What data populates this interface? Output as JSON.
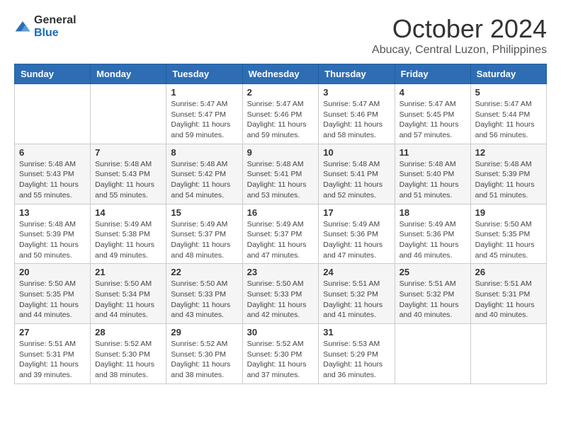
{
  "header": {
    "logo": {
      "text_general": "General",
      "text_blue": "Blue"
    },
    "month": "October 2024",
    "location": "Abucay, Central Luzon, Philippines"
  },
  "days_of_week": [
    "Sunday",
    "Monday",
    "Tuesday",
    "Wednesday",
    "Thursday",
    "Friday",
    "Saturday"
  ],
  "weeks": [
    [
      {
        "day": "",
        "sunrise": "",
        "sunset": "",
        "daylight": ""
      },
      {
        "day": "",
        "sunrise": "",
        "sunset": "",
        "daylight": ""
      },
      {
        "day": "1",
        "sunrise": "Sunrise: 5:47 AM",
        "sunset": "Sunset: 5:47 PM",
        "daylight": "Daylight: 11 hours and 59 minutes."
      },
      {
        "day": "2",
        "sunrise": "Sunrise: 5:47 AM",
        "sunset": "Sunset: 5:46 PM",
        "daylight": "Daylight: 11 hours and 59 minutes."
      },
      {
        "day": "3",
        "sunrise": "Sunrise: 5:47 AM",
        "sunset": "Sunset: 5:46 PM",
        "daylight": "Daylight: 11 hours and 58 minutes."
      },
      {
        "day": "4",
        "sunrise": "Sunrise: 5:47 AM",
        "sunset": "Sunset: 5:45 PM",
        "daylight": "Daylight: 11 hours and 57 minutes."
      },
      {
        "day": "5",
        "sunrise": "Sunrise: 5:47 AM",
        "sunset": "Sunset: 5:44 PM",
        "daylight": "Daylight: 11 hours and 56 minutes."
      }
    ],
    [
      {
        "day": "6",
        "sunrise": "Sunrise: 5:48 AM",
        "sunset": "Sunset: 5:43 PM",
        "daylight": "Daylight: 11 hours and 55 minutes."
      },
      {
        "day": "7",
        "sunrise": "Sunrise: 5:48 AM",
        "sunset": "Sunset: 5:43 PM",
        "daylight": "Daylight: 11 hours and 55 minutes."
      },
      {
        "day": "8",
        "sunrise": "Sunrise: 5:48 AM",
        "sunset": "Sunset: 5:42 PM",
        "daylight": "Daylight: 11 hours and 54 minutes."
      },
      {
        "day": "9",
        "sunrise": "Sunrise: 5:48 AM",
        "sunset": "Sunset: 5:41 PM",
        "daylight": "Daylight: 11 hours and 53 minutes."
      },
      {
        "day": "10",
        "sunrise": "Sunrise: 5:48 AM",
        "sunset": "Sunset: 5:41 PM",
        "daylight": "Daylight: 11 hours and 52 minutes."
      },
      {
        "day": "11",
        "sunrise": "Sunrise: 5:48 AM",
        "sunset": "Sunset: 5:40 PM",
        "daylight": "Daylight: 11 hours and 51 minutes."
      },
      {
        "day": "12",
        "sunrise": "Sunrise: 5:48 AM",
        "sunset": "Sunset: 5:39 PM",
        "daylight": "Daylight: 11 hours and 51 minutes."
      }
    ],
    [
      {
        "day": "13",
        "sunrise": "Sunrise: 5:48 AM",
        "sunset": "Sunset: 5:39 PM",
        "daylight": "Daylight: 11 hours and 50 minutes."
      },
      {
        "day": "14",
        "sunrise": "Sunrise: 5:49 AM",
        "sunset": "Sunset: 5:38 PM",
        "daylight": "Daylight: 11 hours and 49 minutes."
      },
      {
        "day": "15",
        "sunrise": "Sunrise: 5:49 AM",
        "sunset": "Sunset: 5:37 PM",
        "daylight": "Daylight: 11 hours and 48 minutes."
      },
      {
        "day": "16",
        "sunrise": "Sunrise: 5:49 AM",
        "sunset": "Sunset: 5:37 PM",
        "daylight": "Daylight: 11 hours and 47 minutes."
      },
      {
        "day": "17",
        "sunrise": "Sunrise: 5:49 AM",
        "sunset": "Sunset: 5:36 PM",
        "daylight": "Daylight: 11 hours and 47 minutes."
      },
      {
        "day": "18",
        "sunrise": "Sunrise: 5:49 AM",
        "sunset": "Sunset: 5:36 PM",
        "daylight": "Daylight: 11 hours and 46 minutes."
      },
      {
        "day": "19",
        "sunrise": "Sunrise: 5:50 AM",
        "sunset": "Sunset: 5:35 PM",
        "daylight": "Daylight: 11 hours and 45 minutes."
      }
    ],
    [
      {
        "day": "20",
        "sunrise": "Sunrise: 5:50 AM",
        "sunset": "Sunset: 5:35 PM",
        "daylight": "Daylight: 11 hours and 44 minutes."
      },
      {
        "day": "21",
        "sunrise": "Sunrise: 5:50 AM",
        "sunset": "Sunset: 5:34 PM",
        "daylight": "Daylight: 11 hours and 44 minutes."
      },
      {
        "day": "22",
        "sunrise": "Sunrise: 5:50 AM",
        "sunset": "Sunset: 5:33 PM",
        "daylight": "Daylight: 11 hours and 43 minutes."
      },
      {
        "day": "23",
        "sunrise": "Sunrise: 5:50 AM",
        "sunset": "Sunset: 5:33 PM",
        "daylight": "Daylight: 11 hours and 42 minutes."
      },
      {
        "day": "24",
        "sunrise": "Sunrise: 5:51 AM",
        "sunset": "Sunset: 5:32 PM",
        "daylight": "Daylight: 11 hours and 41 minutes."
      },
      {
        "day": "25",
        "sunrise": "Sunrise: 5:51 AM",
        "sunset": "Sunset: 5:32 PM",
        "daylight": "Daylight: 11 hours and 40 minutes."
      },
      {
        "day": "26",
        "sunrise": "Sunrise: 5:51 AM",
        "sunset": "Sunset: 5:31 PM",
        "daylight": "Daylight: 11 hours and 40 minutes."
      }
    ],
    [
      {
        "day": "27",
        "sunrise": "Sunrise: 5:51 AM",
        "sunset": "Sunset: 5:31 PM",
        "daylight": "Daylight: 11 hours and 39 minutes."
      },
      {
        "day": "28",
        "sunrise": "Sunrise: 5:52 AM",
        "sunset": "Sunset: 5:30 PM",
        "daylight": "Daylight: 11 hours and 38 minutes."
      },
      {
        "day": "29",
        "sunrise": "Sunrise: 5:52 AM",
        "sunset": "Sunset: 5:30 PM",
        "daylight": "Daylight: 11 hours and 38 minutes."
      },
      {
        "day": "30",
        "sunrise": "Sunrise: 5:52 AM",
        "sunset": "Sunset: 5:30 PM",
        "daylight": "Daylight: 11 hours and 37 minutes."
      },
      {
        "day": "31",
        "sunrise": "Sunrise: 5:53 AM",
        "sunset": "Sunset: 5:29 PM",
        "daylight": "Daylight: 11 hours and 36 minutes."
      },
      {
        "day": "",
        "sunrise": "",
        "sunset": "",
        "daylight": ""
      },
      {
        "day": "",
        "sunrise": "",
        "sunset": "",
        "daylight": ""
      }
    ]
  ]
}
